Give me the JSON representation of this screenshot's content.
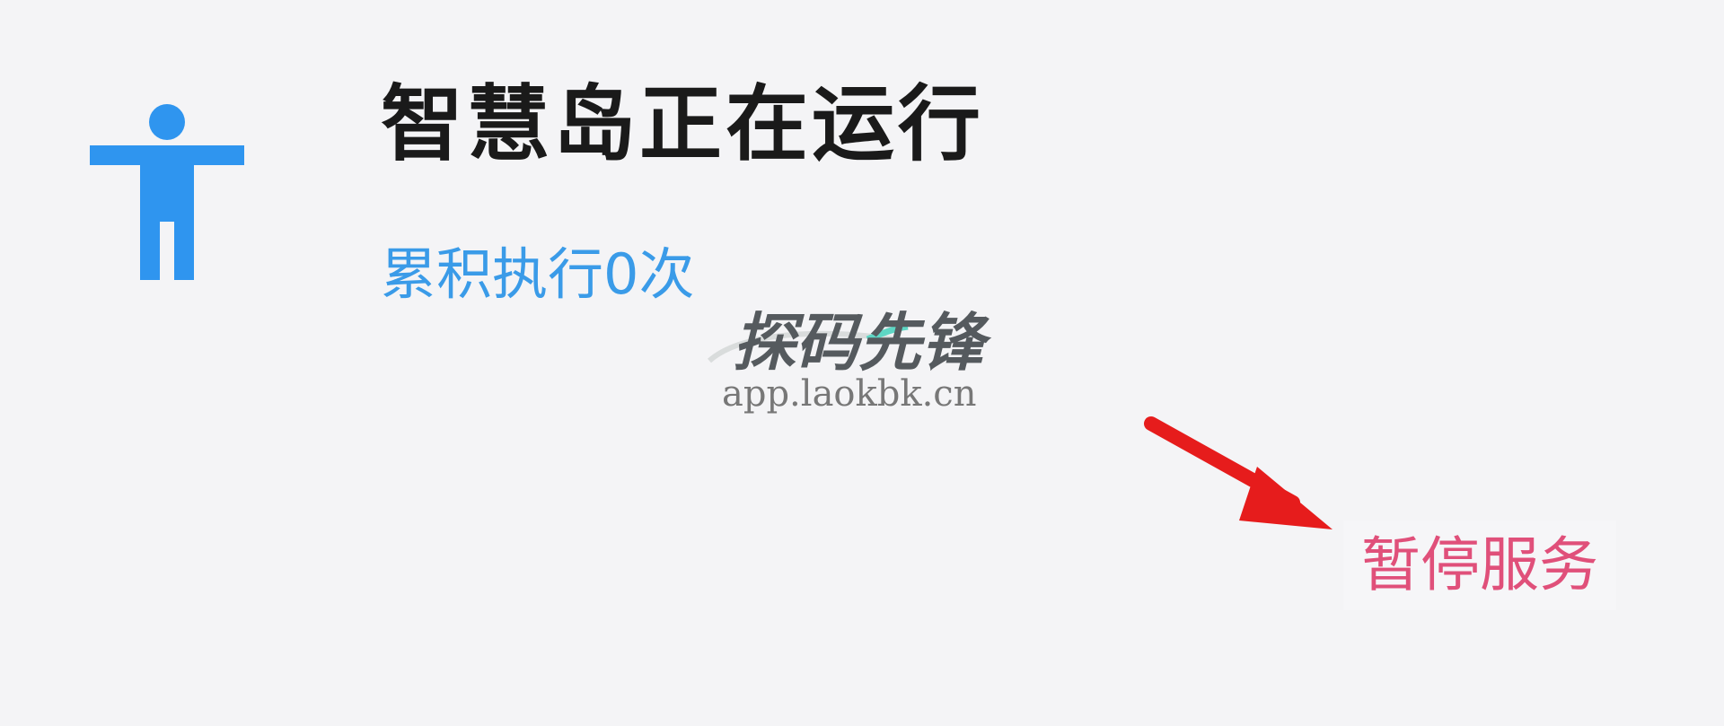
{
  "service": {
    "title": "智慧岛正在运行",
    "execution_count_label": "累积执行0次",
    "subtitle_color": "#3a9be8",
    "icon": "accessibility-person-icon",
    "icon_color": "#2f95ef"
  },
  "actions": {
    "pause_label": "暂停服务",
    "pause_color": "#e0507a"
  },
  "watermark": {
    "brand": "探码先锋",
    "url": "app.laokbk.cn"
  },
  "annotation": {
    "arrow_icon": "red-arrow-icon",
    "arrow_color": "#e61c1c"
  }
}
